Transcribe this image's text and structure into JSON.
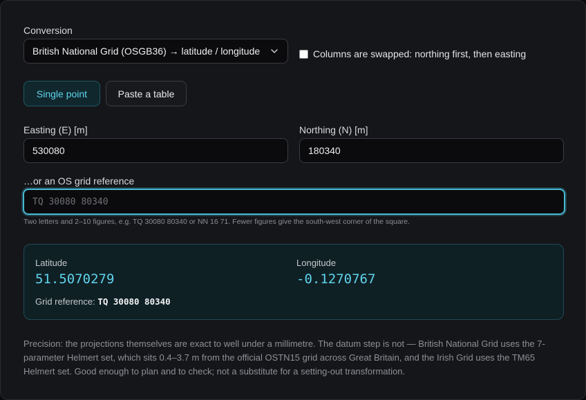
{
  "conversion": {
    "label": "Conversion",
    "selected": "British National Grid (OSGB36) → latitude / longitude",
    "swap_label": "Columns are swapped: northing first, then easting",
    "swap_checked": false
  },
  "mode_tabs": [
    {
      "label": "Single point",
      "active": true
    },
    {
      "label": "Paste a table",
      "active": false
    }
  ],
  "inputs": {
    "easting_label": "Easting (E) [m]",
    "easting_value": "530080",
    "northing_label": "Northing (N) [m]",
    "northing_value": "180340",
    "grid_label": "…or an OS grid reference",
    "grid_placeholder": "TQ 30080 80340",
    "grid_value": "",
    "grid_hint": "Two letters and 2–10 figures, e.g. TQ 30080 80340 or NN 16 71. Fewer figures give the south-west corner of the square."
  },
  "result": {
    "latitude_label": "Latitude",
    "latitude_value": "51.5070279",
    "longitude_label": "Longitude",
    "longitude_value": "-0.1270767",
    "gridref_label": "Grid reference:",
    "gridref_value": "TQ 30080 80340"
  },
  "precision_note": "Precision: the projections themselves are exact to well under a millimetre. The datum step is not — British National Grid uses the 7-parameter Helmert set, which sits 0.4–3.7 m from the official OSTN15 grid across Great Britain, and the Irish Grid uses the TM65 Helmert set. Good enough to plan and to check; not a substitute for a setting-out transformation.",
  "colors": {
    "accent": "#5fd4ec",
    "focus_ring": "#49b9d4",
    "result_bg": "#0f2025",
    "panel_bg": "#151619"
  },
  "icons": {
    "select_chevron": "chevron-down-icon"
  }
}
